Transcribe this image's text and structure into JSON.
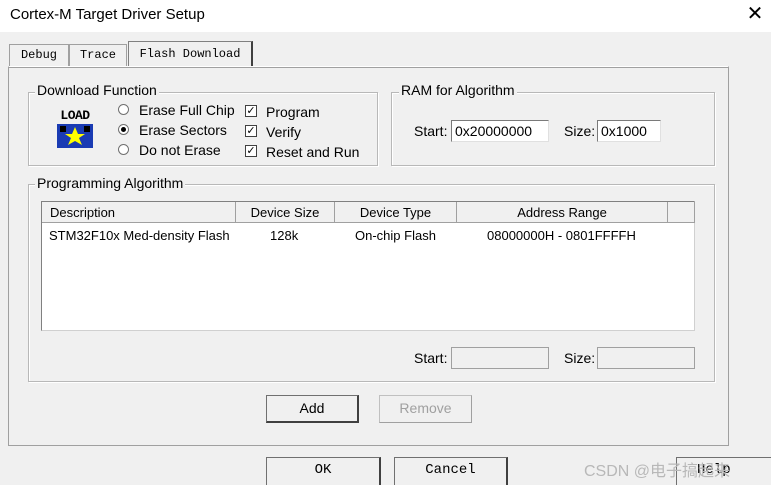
{
  "window": {
    "title": "Cortex-M Target Driver Setup",
    "close_glyph": "✕"
  },
  "tabs": [
    {
      "label": "Debug",
      "active": false
    },
    {
      "label": "Trace",
      "active": false
    },
    {
      "label": "Flash Download",
      "active": true
    }
  ],
  "download_function": {
    "legend": "Download Function",
    "load_icon_text": "LOAD",
    "radios": [
      {
        "label": "Erase Full Chip",
        "selected": false
      },
      {
        "label": "Erase Sectors",
        "selected": true
      },
      {
        "label": "Do not Erase",
        "selected": false
      }
    ],
    "checkboxes": [
      {
        "label": "Program",
        "checked": true
      },
      {
        "label": "Verify",
        "checked": true
      },
      {
        "label": "Reset and Run",
        "checked": true
      }
    ],
    "check_glyph": "✓"
  },
  "ram_for_algorithm": {
    "legend": "RAM for Algorithm",
    "start_label": "Start:",
    "start_value": "0x20000000",
    "size_label": "Size:",
    "size_value": "0x1000"
  },
  "programming_algorithm": {
    "legend": "Programming Algorithm",
    "columns": [
      "Description",
      "Device Size",
      "Device Type",
      "Address Range"
    ],
    "rows": [
      [
        "STM32F10x Med-density Flash",
        "128k",
        "On-chip Flash",
        "08000000H - 0801FFFFH"
      ]
    ],
    "start_label": "Start:",
    "start_value": "",
    "size_label": "Size:",
    "size_value": ""
  },
  "buttons": {
    "add": "Add",
    "remove": "Remove",
    "ok": "OK",
    "cancel": "Cancel",
    "help": "Help"
  },
  "watermark": "CSDN @电子搞起来"
}
